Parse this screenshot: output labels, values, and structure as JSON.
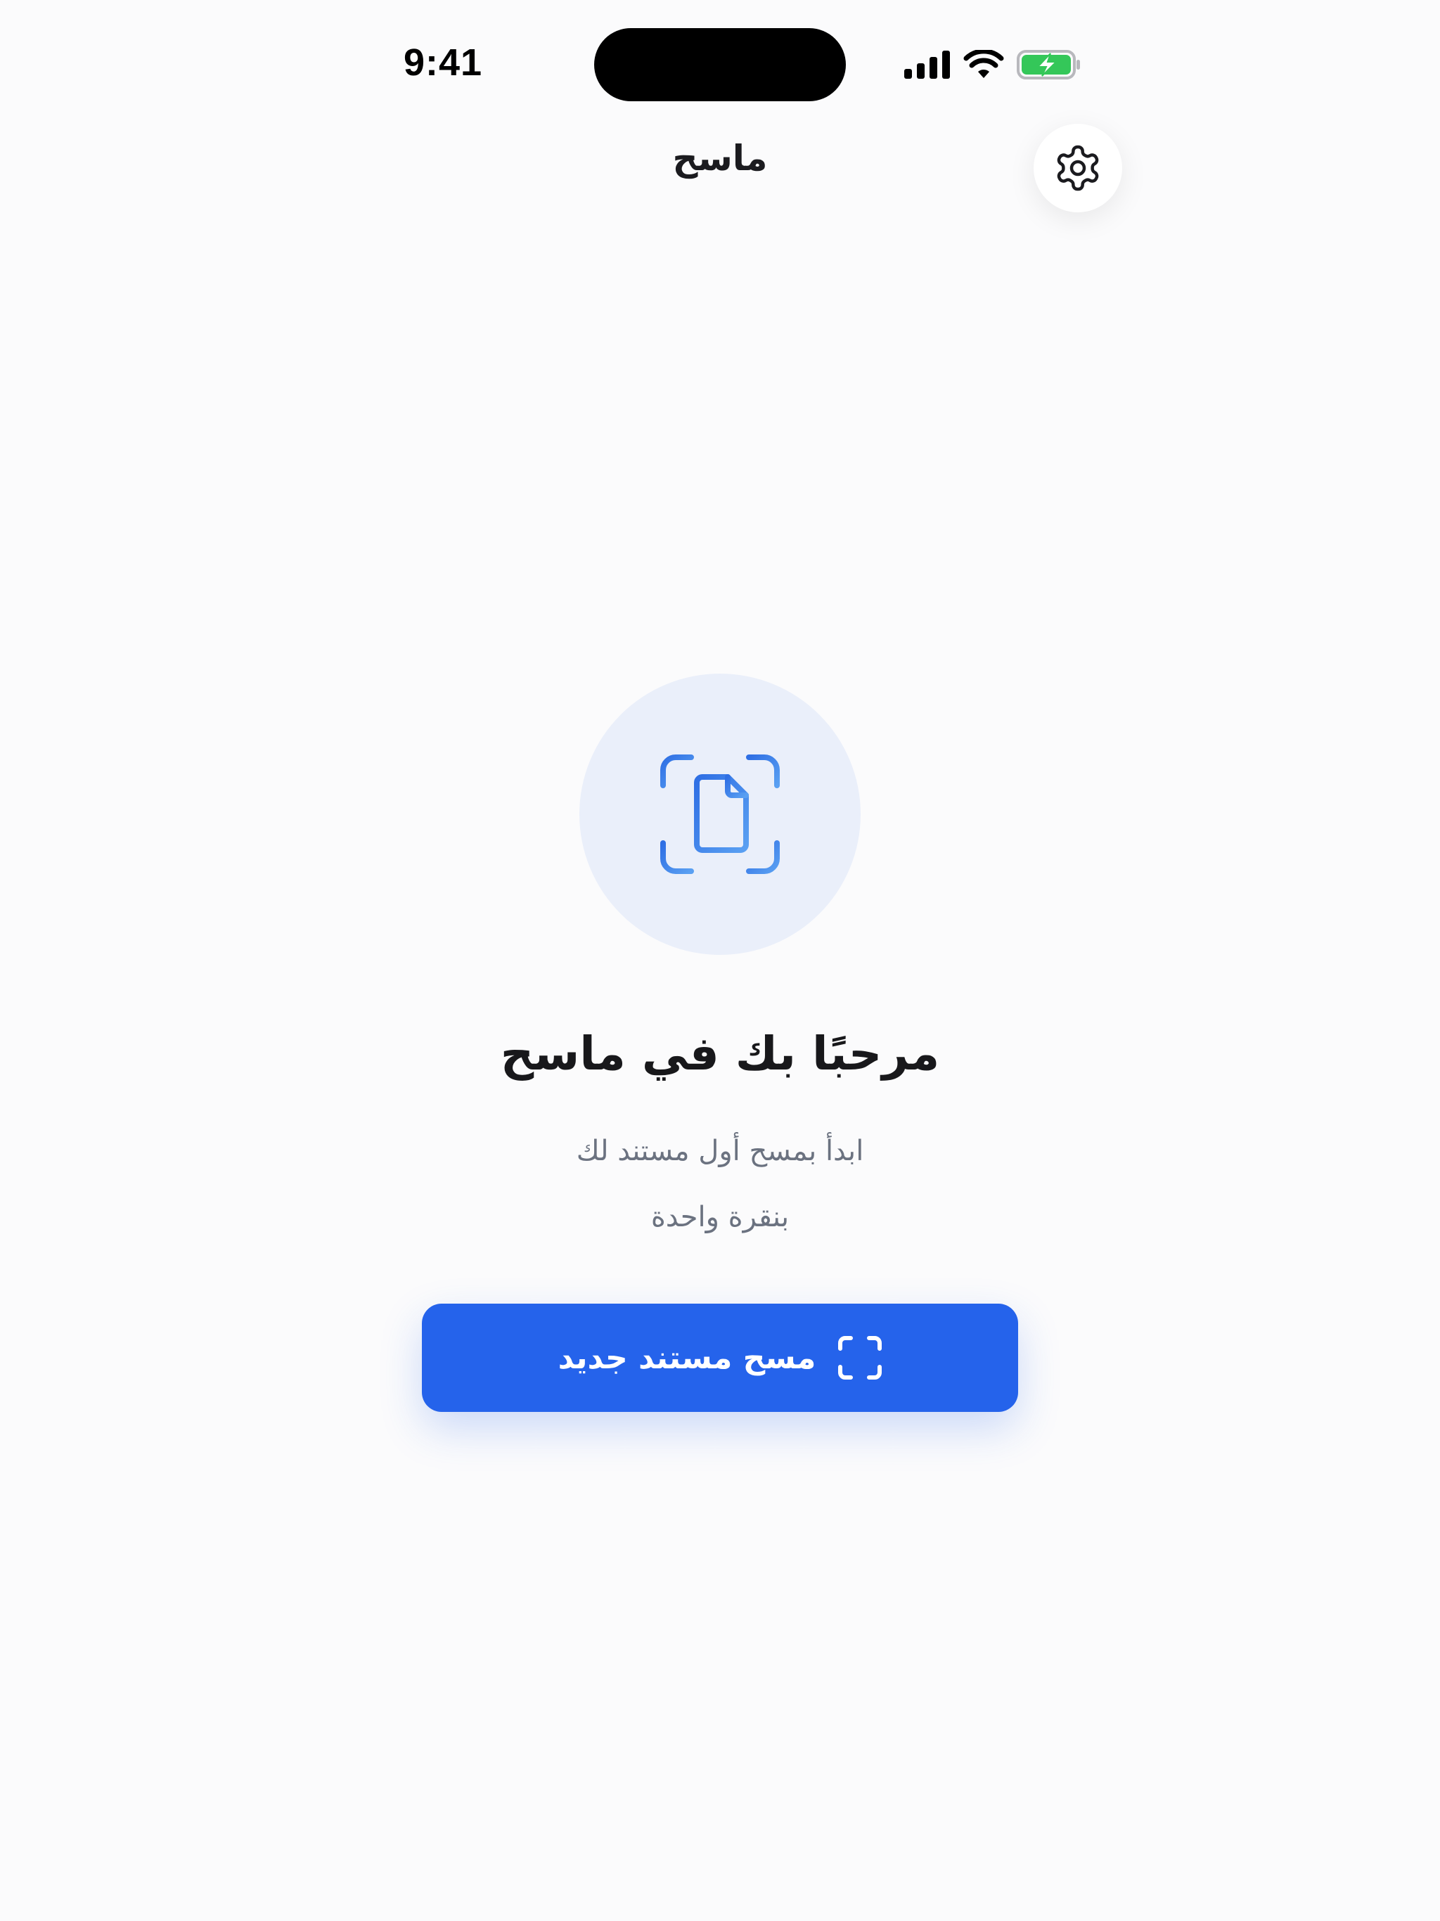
{
  "status_bar": {
    "time": "9:41"
  },
  "nav": {
    "title": "ماسح"
  },
  "empty_state": {
    "title": "مرحبًا بك في ماسح",
    "subtitle_line1": "ابدأ بمسح أول مستند لك",
    "subtitle_line2": "بنقرة واحدة"
  },
  "primary_action": {
    "label": "مسح مستند جديد"
  },
  "icons": {
    "settings": "gear-icon",
    "hero": "document-scan-icon",
    "scan": "scan-frame-icon"
  },
  "colors": {
    "accent": "#2563eb",
    "hero_bg": "#eaeffa",
    "battery": "#34c759"
  }
}
